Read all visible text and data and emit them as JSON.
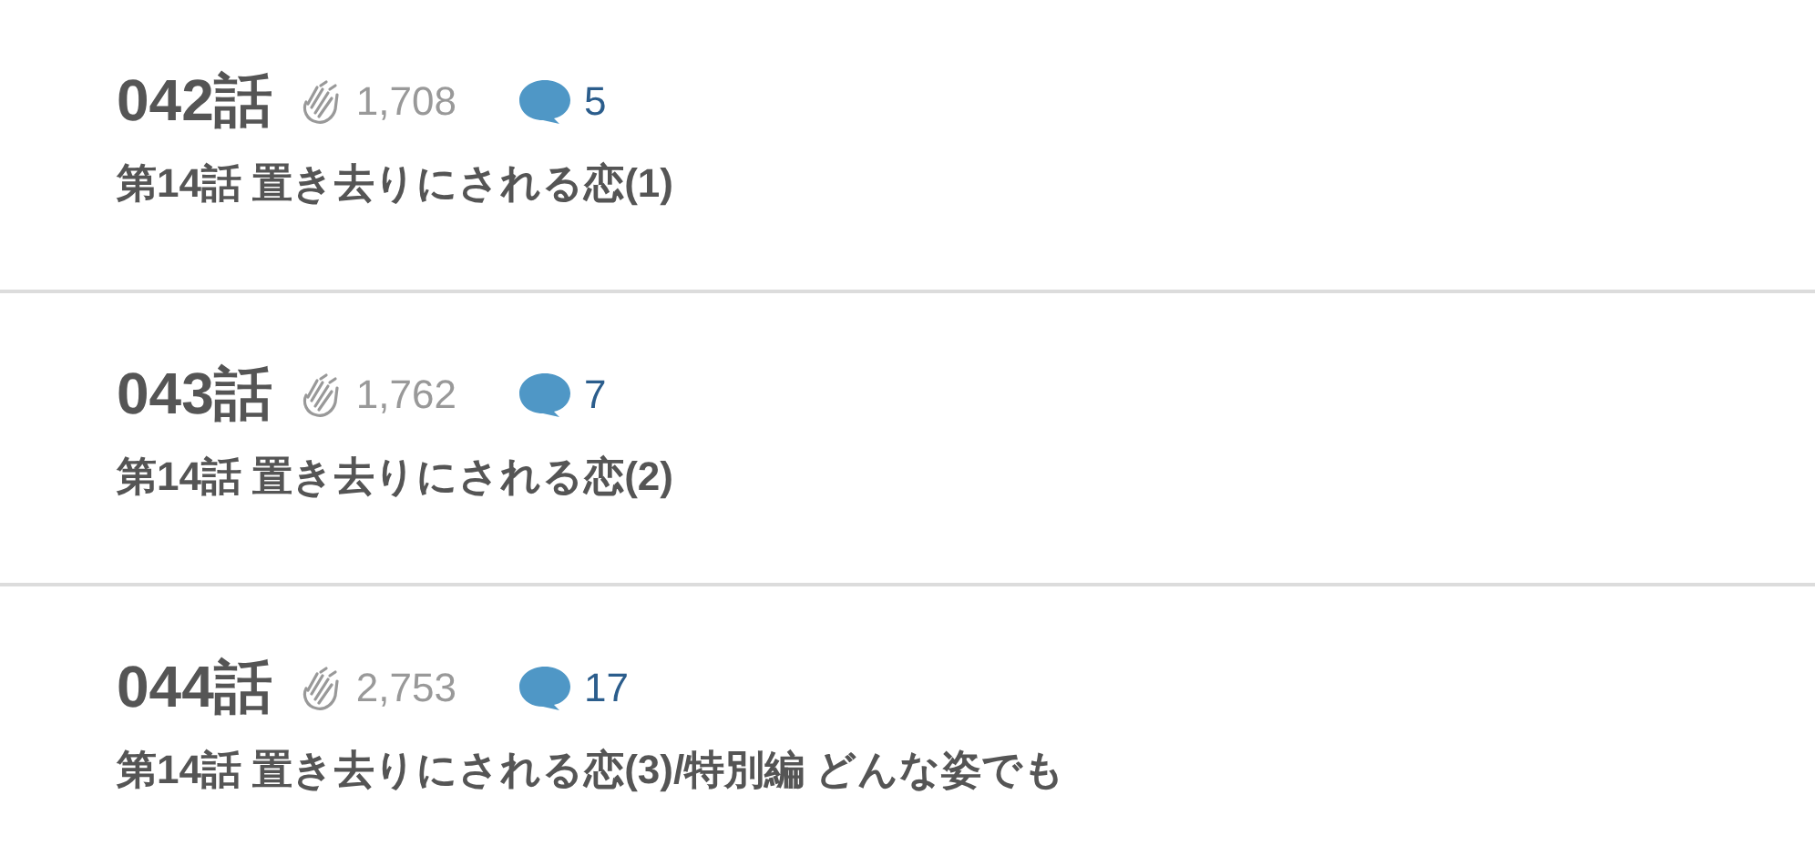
{
  "episodes": [
    {
      "number": "042話",
      "claps": "1,708",
      "comments": "5",
      "title": "第14話 置き去りにされる恋(1)"
    },
    {
      "number": "043話",
      "claps": "1,762",
      "comments": "7",
      "title": "第14話 置き去りにされる恋(2)"
    },
    {
      "number": "044話",
      "claps": "2,753",
      "comments": "17",
      "title": "第14話 置き去りにされる恋(3)/特別編 どんな姿でも"
    }
  ]
}
